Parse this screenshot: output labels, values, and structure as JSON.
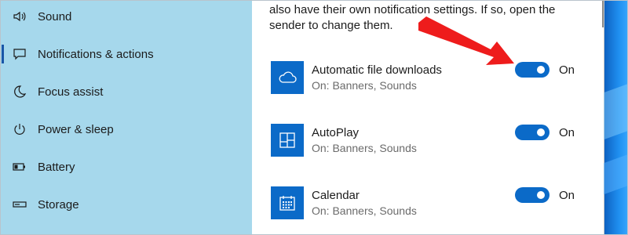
{
  "sidebar": {
    "items": [
      {
        "label": "Sound",
        "icon": "speaker-icon",
        "selected": false
      },
      {
        "label": "Notifications & actions",
        "icon": "message-icon",
        "selected": true
      },
      {
        "label": "Focus assist",
        "icon": "moon-icon",
        "selected": false
      },
      {
        "label": "Power & sleep",
        "icon": "power-icon",
        "selected": false
      },
      {
        "label": "Battery",
        "icon": "battery-icon",
        "selected": false
      },
      {
        "label": "Storage",
        "icon": "storage-icon",
        "selected": false
      }
    ]
  },
  "content": {
    "description_lines": [
      "also have their own notification settings. If so, open the",
      "sender to change them."
    ],
    "apps": [
      {
        "name": "Automatic file downloads",
        "sub": "On: Banners, Sounds",
        "state": "On",
        "icon": "cloud-icon"
      },
      {
        "name": "AutoPlay",
        "sub": "On: Banners, Sounds",
        "state": "On",
        "icon": "autoplay-icon"
      },
      {
        "name": "Calendar",
        "sub": "On: Banners, Sounds",
        "state": "On",
        "icon": "calendar-icon"
      }
    ]
  },
  "colors": {
    "sidebar_bg": "#a6d8ec",
    "accent": "#0b6ac8",
    "annotation_arrow": "#ee1c1c"
  }
}
